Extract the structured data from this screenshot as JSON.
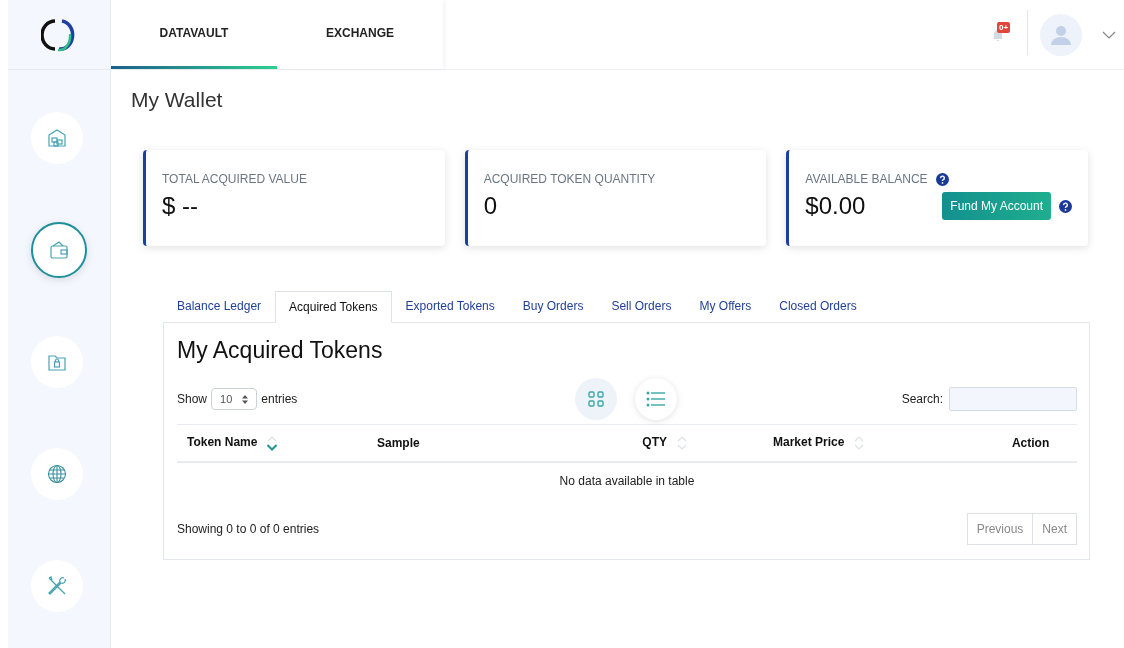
{
  "top_tabs": [
    {
      "label": "DATAVAULT",
      "selected": true
    },
    {
      "label": "EXCHANGE",
      "selected": false
    }
  ],
  "header": {
    "notification_badge": "0+"
  },
  "sidebar": {
    "items": [
      {
        "kind": "warehouse",
        "selected": false
      },
      {
        "kind": "wallet",
        "selected": true
      },
      {
        "kind": "folder-lock",
        "selected": false
      },
      {
        "kind": "globe",
        "selected": false
      },
      {
        "kind": "tools",
        "selected": false
      }
    ]
  },
  "page_title": "My Wallet",
  "cards": [
    {
      "label": "TOTAL ACQUIRED VALUE",
      "value": "$ --"
    },
    {
      "label": "ACQUIRED TOKEN QUANTITY",
      "value": "0"
    },
    {
      "label": "AVAILABLE BALANCE",
      "value": "$0.00",
      "help": true,
      "button": "Fund My Account"
    }
  ],
  "tabs": [
    {
      "label": "Balance Ledger",
      "selected": false
    },
    {
      "label": "Acquired Tokens",
      "selected": true
    },
    {
      "label": "Exported Tokens",
      "selected": false
    },
    {
      "label": "Buy Orders",
      "selected": false
    },
    {
      "label": "Sell Orders",
      "selected": false
    },
    {
      "label": "My Offers",
      "selected": false
    },
    {
      "label": "Closed Orders",
      "selected": false
    }
  ],
  "panel": {
    "title": "My Acquired Tokens",
    "show_label": "Show",
    "page_size": "10",
    "entries_label": "entries",
    "view_toggle": [
      {
        "kind": "grid",
        "selected": false
      },
      {
        "kind": "list",
        "selected": true
      }
    ],
    "search_label": "Search:",
    "table": {
      "columns": [
        {
          "label": "Token Name",
          "sortable": true,
          "sorted": true
        },
        {
          "label": "Sample",
          "sortable": false,
          "sorted": false
        },
        {
          "label": "QTY",
          "sortable": true,
          "sorted": false
        },
        {
          "label": "Market Price",
          "sortable": true,
          "sorted": false
        },
        {
          "label": "Action",
          "sortable": false,
          "sorted": false
        }
      ],
      "empty_message": "No data available in table"
    },
    "info": "Showing 0 to 0 of 0 entries",
    "pagination": [
      {
        "label": "Previous",
        "disabled": true
      },
      {
        "label": "Next",
        "disabled": true
      }
    ]
  }
}
